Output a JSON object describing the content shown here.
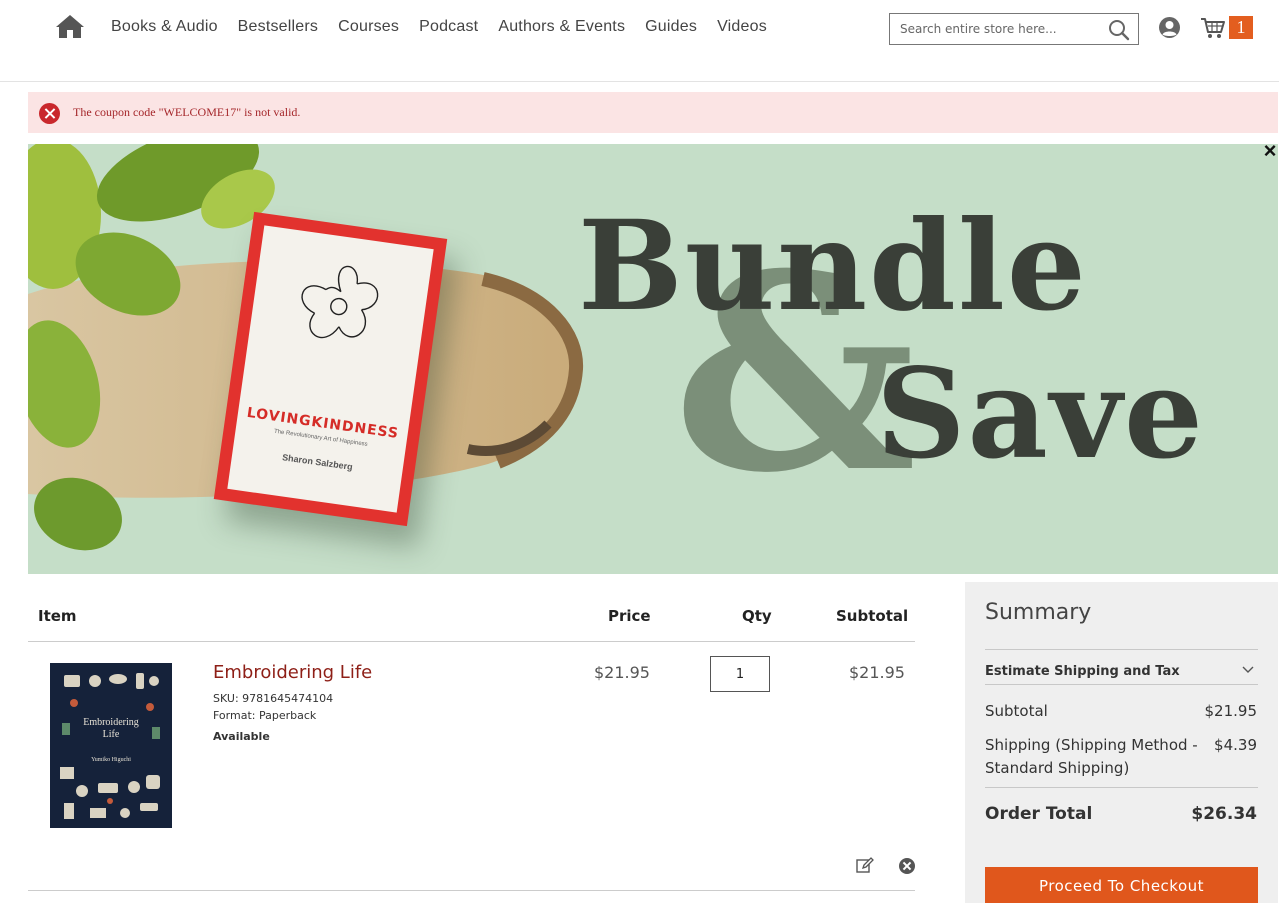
{
  "header": {
    "nav": [
      "Books & Audio",
      "Bestsellers",
      "Courses",
      "Podcast",
      "Authors & Events",
      "Guides",
      "Videos"
    ],
    "search_placeholder": "Search entire store here...",
    "cart_count": "1",
    "icons": {
      "home": "home-icon",
      "search": "search-icon",
      "account": "user-account-icon",
      "cart": "shopping-cart-icon"
    }
  },
  "message": {
    "text": "The coupon code \"WELCOME17\" is not valid.",
    "type": "error",
    "color": "#a5272b",
    "background": "#fbe4e4"
  },
  "banner": {
    "headline_1": "Bundle",
    "ampersand": "&",
    "headline_2": "Save",
    "book_title": "LOVINGKINDNESS",
    "book_subtitle": "The Revolutionary Art of Happiness",
    "book_author": "Sharon Salzberg",
    "close_label": "×",
    "background": "#c5dec8"
  },
  "cart": {
    "columns": {
      "item": "Item",
      "price": "Price",
      "qty": "Qty",
      "subtotal": "Subtotal"
    },
    "items": [
      {
        "name": "Embroidering Life",
        "sku": "SKU: 9781645474104",
        "format": "Format: Paperback",
        "availability": "Available",
        "price": "$21.95",
        "qty": "1",
        "subtotal": "$21.95",
        "cover_title": "Embroidering Life",
        "cover_author": "Yumiko Higuchi"
      }
    ]
  },
  "summary": {
    "title": "Summary",
    "estimate_label": "Estimate Shipping and Tax",
    "subtotal_label": "Subtotal",
    "subtotal_value": "$21.95",
    "shipping_label": "Shipping (Shipping Method - Standard Shipping)",
    "shipping_value": "$4.39",
    "order_total_label": "Order Total",
    "order_total_value": "$26.34",
    "checkout_label": "Proceed To Checkout",
    "accent_color": "#e0571c"
  }
}
